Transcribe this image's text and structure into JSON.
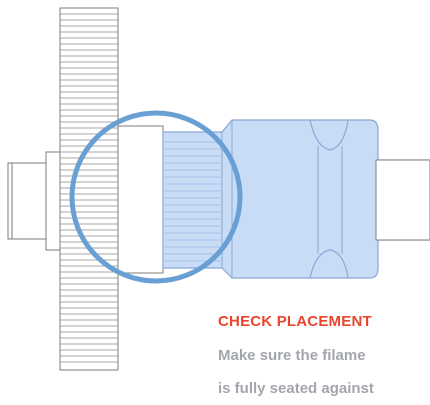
{
  "caption": {
    "title": "CHECK PLACEMENT",
    "line1": "Make sure the filame",
    "line2": "is fully seated against"
  },
  "colors": {
    "callout": "#e8452c",
    "body_text": "#a3a6ab",
    "part_fill": "#c9dcf6",
    "part_stroke": "#8aa7d6",
    "ring": "#6a9fd4",
    "line": "#7d7d7d"
  },
  "icons": [
    "magnifier-circle"
  ]
}
